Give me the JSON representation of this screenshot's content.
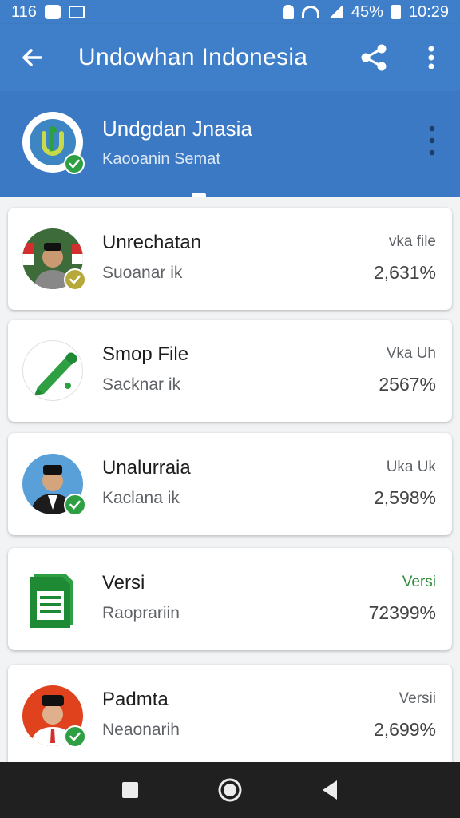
{
  "status_bar": {
    "left_text": "116",
    "battery": "45%",
    "time": "10:29"
  },
  "app_bar": {
    "title": "Undowhan Indonesia",
    "icons": [
      "back-arrow-icon",
      "share-icon",
      "more-vert-icon"
    ]
  },
  "header": {
    "title": "Undgdan Jnasia",
    "subtitle": "Kaooanin Semat"
  },
  "items": [
    {
      "title": "Unrechatan",
      "subtitle": "Suoanar ik",
      "tag": "vka file",
      "value": "2,631%",
      "avatar": "person-flag-avatar",
      "badge": "olive"
    },
    {
      "title": "Smop File",
      "subtitle": "Sacknar ik",
      "tag": "Vka Uh",
      "value": "2567%",
      "avatar": "pen-icon",
      "badge": "none"
    },
    {
      "title": "Unalurraia",
      "subtitle": "Kaclana ik",
      "tag": "Uka Uk",
      "value": "2,598%",
      "avatar": "person-cap-avatar",
      "badge": "green"
    },
    {
      "title": "Versi",
      "subtitle": "Raoprariin",
      "tag": "Versi",
      "value": "72399%",
      "avatar": "document-icon",
      "badge": "none",
      "tag_color": "#2e8b3a"
    },
    {
      "title": "Padmta",
      "subtitle": "Neaonarih",
      "tag": "Versii",
      "value": "2,699%",
      "avatar": "person-red-avatar",
      "badge": "green"
    }
  ],
  "colors": {
    "primary": "#3f7fc9",
    "accent_green": "#2ea043",
    "nav_bar": "#202020"
  }
}
